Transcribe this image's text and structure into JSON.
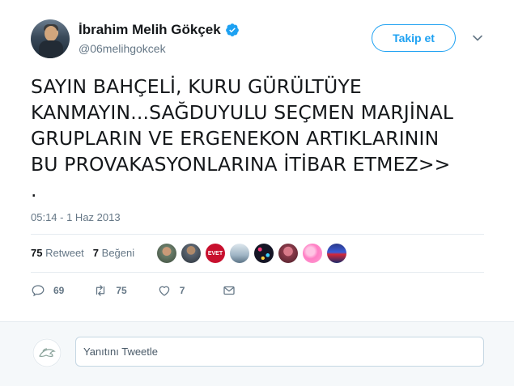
{
  "author": {
    "name": "İbrahim Melih Gökçek",
    "handle": "@06melihgokcek",
    "avatar_icon": "profile-photo",
    "verified_icon": "verified-badge-icon"
  },
  "header": {
    "follow_label": "Takip et",
    "more_icon": "chevron-down-icon"
  },
  "tweet": {
    "text": "SAYIN BAHÇELİ, KURU GÜRÜLTÜYE\nKANMAYIN...SAĞDUYULU SEÇMEN MARJİNAL\nGRUPLARIN VE ERGENEKON ARTIKLARININ\nBU PROVAKASYONLARINA İTİBAR ETMEZ>>\n.",
    "timestamp": "05:14 - 1 Haz 2013"
  },
  "stats": {
    "retweet_count": "75",
    "retweet_label": "Retweet",
    "like_count": "7",
    "like_label": "Beğeni"
  },
  "likers": [
    {
      "name": "liker-avatar-1"
    },
    {
      "name": "liker-avatar-2"
    },
    {
      "name": "liker-avatar-3",
      "badge_text": "EVET"
    },
    {
      "name": "liker-avatar-4"
    },
    {
      "name": "liker-avatar-5"
    },
    {
      "name": "liker-avatar-6"
    },
    {
      "name": "liker-avatar-7"
    },
    {
      "name": "liker-avatar-8"
    }
  ],
  "actions": {
    "reply_count": "69",
    "retweet_count": "75",
    "like_count": "7"
  },
  "reply": {
    "placeholder": "Yanıtını Tweetle"
  },
  "colors": {
    "accent": "#1da1f2",
    "secondary_text": "#657786",
    "primary_text": "#14171a"
  }
}
